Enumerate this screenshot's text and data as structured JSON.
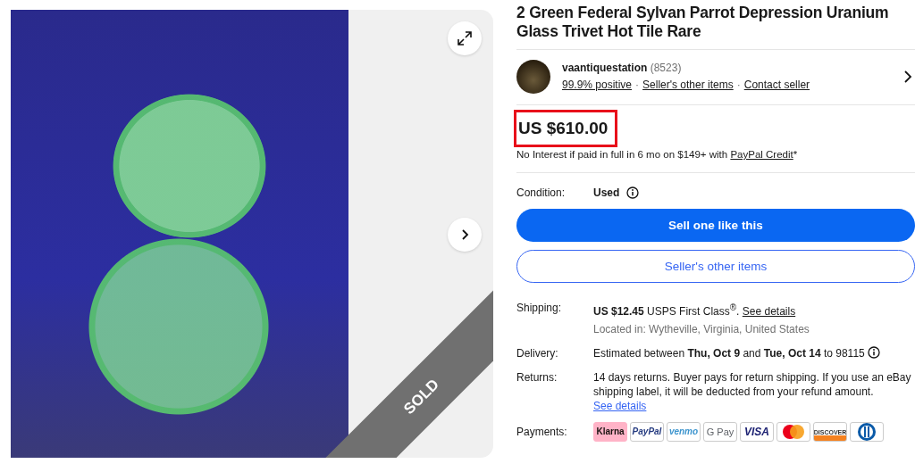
{
  "gallery": {
    "sold": true,
    "badge": "SOLD"
  },
  "title": "2 Green Federal Sylvan Parrot Depression Uranium Glass Trivet Hot Tile Rare",
  "seller": {
    "name": "vaantiquestation",
    "count": "(8523)",
    "separator": "·",
    "links": [
      "99.9% positive",
      "Seller's other items",
      "Contact seller"
    ]
  },
  "price": {
    "amount": "US $610.00",
    "highlighted": true,
    "financing": "No Interest if paid in full in 6 mo on $149+ with",
    "financing_link": "PayPal Credit",
    "financing_mark": "*"
  },
  "condition": {
    "label": "Condition:",
    "value": "Used"
  },
  "buttons": [
    {
      "label": "Sell one like this",
      "kind": "primary"
    },
    {
      "label": "Seller's other items",
      "kind": "secondary"
    }
  ],
  "shipping": {
    "label": "Shipping:",
    "text": "**US $12.45** USPS First Class$^{®}$.",
    "link": "See details",
    "location": "Located in: Wytheville, Virginia, United States"
  },
  "delivery": {
    "label": "Delivery:",
    "text": "Estimated between **Thu, Oct 9** and **Tue, Oct 14** to 98115"
  },
  "returns": {
    "label": "Returns:",
    "text": "14 days returns. Buyer pays for return shipping. If you use an eBay shipping label, it will be deducted from your refund amount.",
    "link": "See details"
  },
  "payments": {
    "label": "Payments:",
    "methods": [
      {
        "kind": "klarna",
        "label": "Klarna"
      },
      {
        "kind": "paypal",
        "label": "PayPal"
      },
      {
        "kind": "venmo",
        "label": "venmo"
      },
      {
        "kind": "gpay",
        "label": "G Pay"
      },
      {
        "kind": "visa",
        "label": "VISA"
      },
      {
        "kind": "mastercard"
      },
      {
        "kind": "discover",
        "label": "DISCOVER"
      },
      {
        "kind": "diners"
      }
    ]
  }
}
